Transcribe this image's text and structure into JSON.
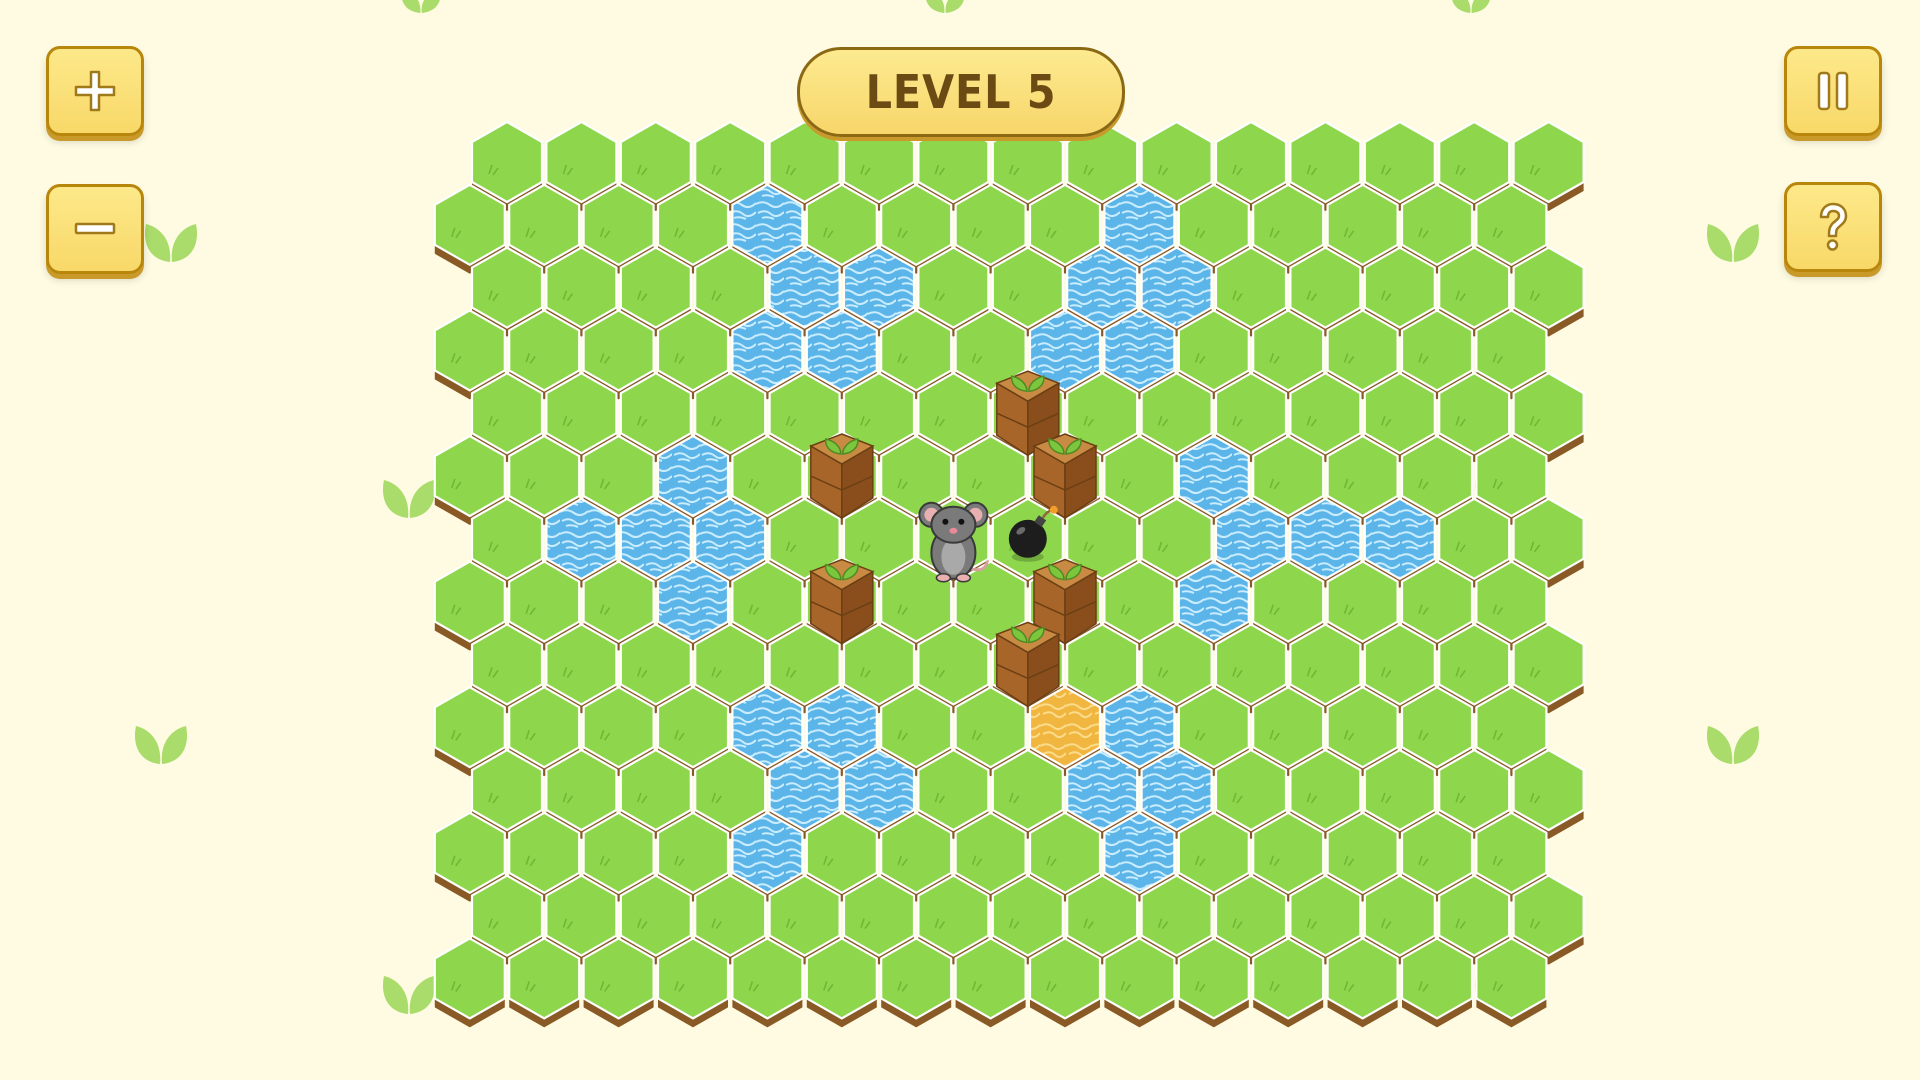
{
  "level_label": "LEVEL 5",
  "buttons": {
    "zoom_in": "plus-icon",
    "zoom_out": "minus-icon",
    "pause": "pause-icon",
    "help": "question-icon"
  },
  "board": {
    "columns": 15,
    "rows": 14,
    "water": [
      [
        1,
        4
      ],
      [
        1,
        9
      ],
      [
        2,
        4
      ],
      [
        2,
        5
      ],
      [
        2,
        8
      ],
      [
        2,
        9
      ],
      [
        3,
        4
      ],
      [
        3,
        5
      ],
      [
        3,
        8
      ],
      [
        3,
        9
      ],
      [
        5,
        3
      ],
      [
        5,
        10
      ],
      [
        6,
        1
      ],
      [
        6,
        2
      ],
      [
        6,
        3
      ],
      [
        6,
        10
      ],
      [
        6,
        11
      ],
      [
        6,
        12
      ],
      [
        7,
        3
      ],
      [
        7,
        10
      ],
      [
        9,
        4
      ],
      [
        9,
        5
      ],
      [
        9,
        9
      ],
      [
        10,
        4
      ],
      [
        10,
        5
      ],
      [
        10,
        8
      ],
      [
        10,
        9
      ],
      [
        11,
        4
      ],
      [
        11,
        9
      ]
    ],
    "sand": [
      [
        9,
        8
      ]
    ],
    "crates": [
      [
        4,
        7
      ],
      [
        5,
        5
      ],
      [
        5,
        8
      ],
      [
        7,
        5
      ],
      [
        7,
        8
      ],
      [
        8,
        7
      ]
    ],
    "mouse": [
      6,
      6
    ],
    "bomb": [
      6,
      7
    ]
  },
  "colors": {
    "background": "#fefbe2",
    "grass": "#8ed64c",
    "water": "#5bb5e8",
    "sand": "#f0b640",
    "crate": "#b8742c",
    "dirt": "#8a5a26"
  }
}
